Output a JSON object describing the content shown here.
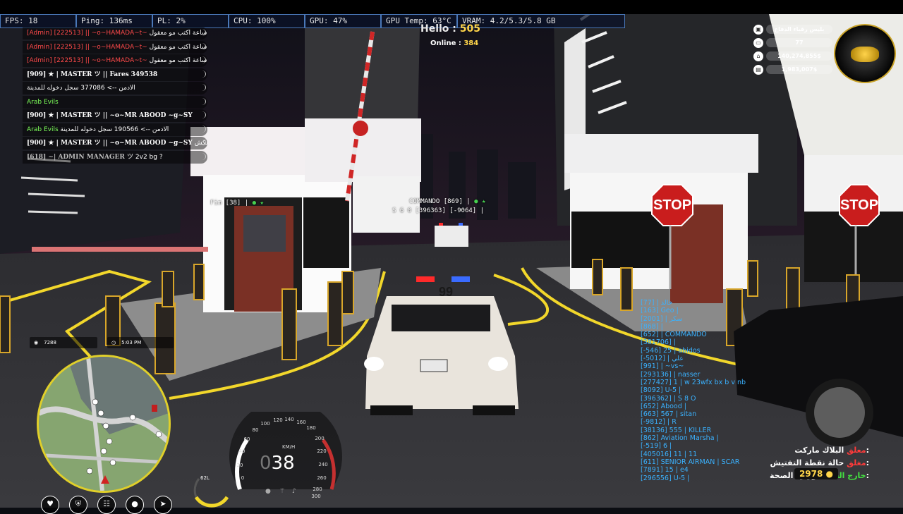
{
  "perf": {
    "fps": "FPS: 18",
    "ping": "Ping: 136ms",
    "pl": "PL: 2%",
    "cpu": "CPU: 100%",
    "gpu": "GPU: 47%",
    "gpu_temp": "GPU Temp: 63°C",
    "vram": "VRAM: 4.2/5.3/5.8 GB"
  },
  "server": {
    "hello_label": "Hello :",
    "hello_value": "505",
    "online_label": "Online :",
    "online_value": "384"
  },
  "chat": [
    {
      "prefix": "[Admin] [222513] || ~o~HAMADA~t~",
      "msg": "لي ساعة اكتب مو معقول",
      "kind": "admin"
    },
    {
      "prefix": "[Admin] [222513] || ~o~HAMADA~t~",
      "msg": "لي ساعة اكتب مو معقول",
      "kind": "admin"
    },
    {
      "prefix": "[Admin] [222513] || ~o~HAMADA~t~",
      "msg": "لي ساعة اكتب مو معقول",
      "kind": "admin"
    },
    {
      "prefix": "[909] ★ | MASTER ツ || Fares",
      "msg": "349538",
      "kind": "bold"
    },
    {
      "prefix": "",
      "msg": "الادمن --> 377086 سجل دخوله للمدينة",
      "kind": "plain"
    },
    {
      "prefix": "Arab Evils",
      "msg": "",
      "kind": "green"
    },
    {
      "prefix": "[900] ★ | MASTER ツ || ~o~MR ABOOD ~g~SY",
      "msg": "",
      "kind": "bold"
    },
    {
      "prefix": "Arab Evils",
      "msg": "الادمن --> 190566 سجل دخوله للمدينة",
      "kind": "green"
    },
    {
      "prefix": "[900] ★ | MASTER ツ || ~o~MR ABOOD ~g~SY",
      "msg": "مكلكش",
      "kind": "bold"
    },
    {
      "prefix": "[618] ~| ADMIN MANAGER ツ",
      "msg": "2v2 bg ?",
      "kind": "gray"
    }
  ],
  "money": {
    "title": "بليس رقباء الدفاع",
    "level": "77",
    "bank": "140,274,855$",
    "cash": "1,983,007$"
  },
  "hud": {
    "postal": "7288",
    "clock": "5:03 PM",
    "speed_dim": "0",
    "speed": "38",
    "unit": "KM/H",
    "fuel": "62L",
    "gauge_ticks": [
      "0",
      "20",
      "40",
      "60",
      "80",
      "100",
      "120",
      "140",
      "160",
      "180",
      "200",
      "220",
      "240",
      "260",
      "280",
      "300"
    ]
  },
  "nametags": {
    "fim": "Fim [38] |",
    "commando": "COMMANDO [869] |",
    "commando_sub": "S 6 0 [396363]",
    "commando_sub2": "[-9064] |"
  },
  "playerlist": [
    "[77] | خالد",
    "[163] Geo |",
    "[2001] | سكر",
    "[868] |",
    "[652] | COMMANDO",
    "[381706] |",
    "[-546] 25 | abidos",
    "[-5012] | علي",
    "[991] | ~vs~",
    "[293136] | nasser",
    "[277427] 1 | w 23wfx bx b v nb",
    "[8092] U-5 |",
    "[396362] | S 8 O",
    "[652] Abood |",
    "[663] 567 | sitan",
    "[-9812] | R",
    "[38136] 555 | KILLER",
    "[862] Aviation Marsha |",
    "[-519] 6 |",
    "[405016] 11 | 11",
    "[611] SENIOR AIRMAN | SCAR",
    "[7891] 15 | e4",
    "[296556] U-5 |"
  ],
  "status": {
    "market_label": "البلاك ماركت:",
    "market_value": "معلق",
    "checkpoint_label": "حالة نقطة التفتيش:",
    "checkpoint_value": "مغلق",
    "ministry_label": "وزارة الصحة:",
    "ministry_value": "خارج الخدمة",
    "coins": "2978"
  },
  "icons": [
    "heart-icon",
    "shield-icon",
    "food-icon",
    "water-icon",
    "run-icon"
  ],
  "colors": {
    "perf_border": "#4a78b8",
    "admin": "#ff4a4a",
    "green": "#7dff5a",
    "accent": "#ffd54a",
    "player_blue": "#3ab2ff",
    "minimap_ring": "#e0cf2a"
  }
}
